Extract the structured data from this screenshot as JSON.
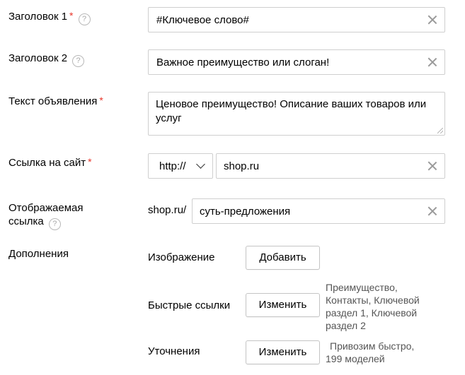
{
  "fields": {
    "headline1": {
      "label": "Заголовок 1",
      "required": "*",
      "help": "?",
      "value": "#Ключевое слово#"
    },
    "headline2": {
      "label": "Заголовок 2",
      "help": "?",
      "value": "Важное преимущество или слоган!"
    },
    "ad_text": {
      "label": "Текст объявления",
      "required": "*",
      "value": "Ценовое преимущество! Описание ваших товаров или услуг"
    },
    "site_link": {
      "label": "Ссылка на сайт",
      "required": "*",
      "protocol": "http://",
      "value": "shop.ru"
    },
    "display_link": {
      "label_line1": "Отображаемая",
      "label_line2": "ссылка",
      "help": "?",
      "prefix": "shop.ru/",
      "value": "суть-предложения"
    }
  },
  "extensions": {
    "label": "Дополнения",
    "image": {
      "label": "Изображение",
      "button": "Добавить"
    },
    "quick_links": {
      "label": "Быстрые ссылки",
      "button": "Изменить",
      "note_lines": [
        "Преимущество,",
        "Контакты, Ключевой",
        "раздел 1, Ключевой",
        "раздел 2"
      ]
    },
    "clarifications": {
      "label": "Уточнения",
      "button": "Изменить",
      "note_lines": [
        "Привозим быстро,",
        "199 моделей"
      ]
    }
  }
}
